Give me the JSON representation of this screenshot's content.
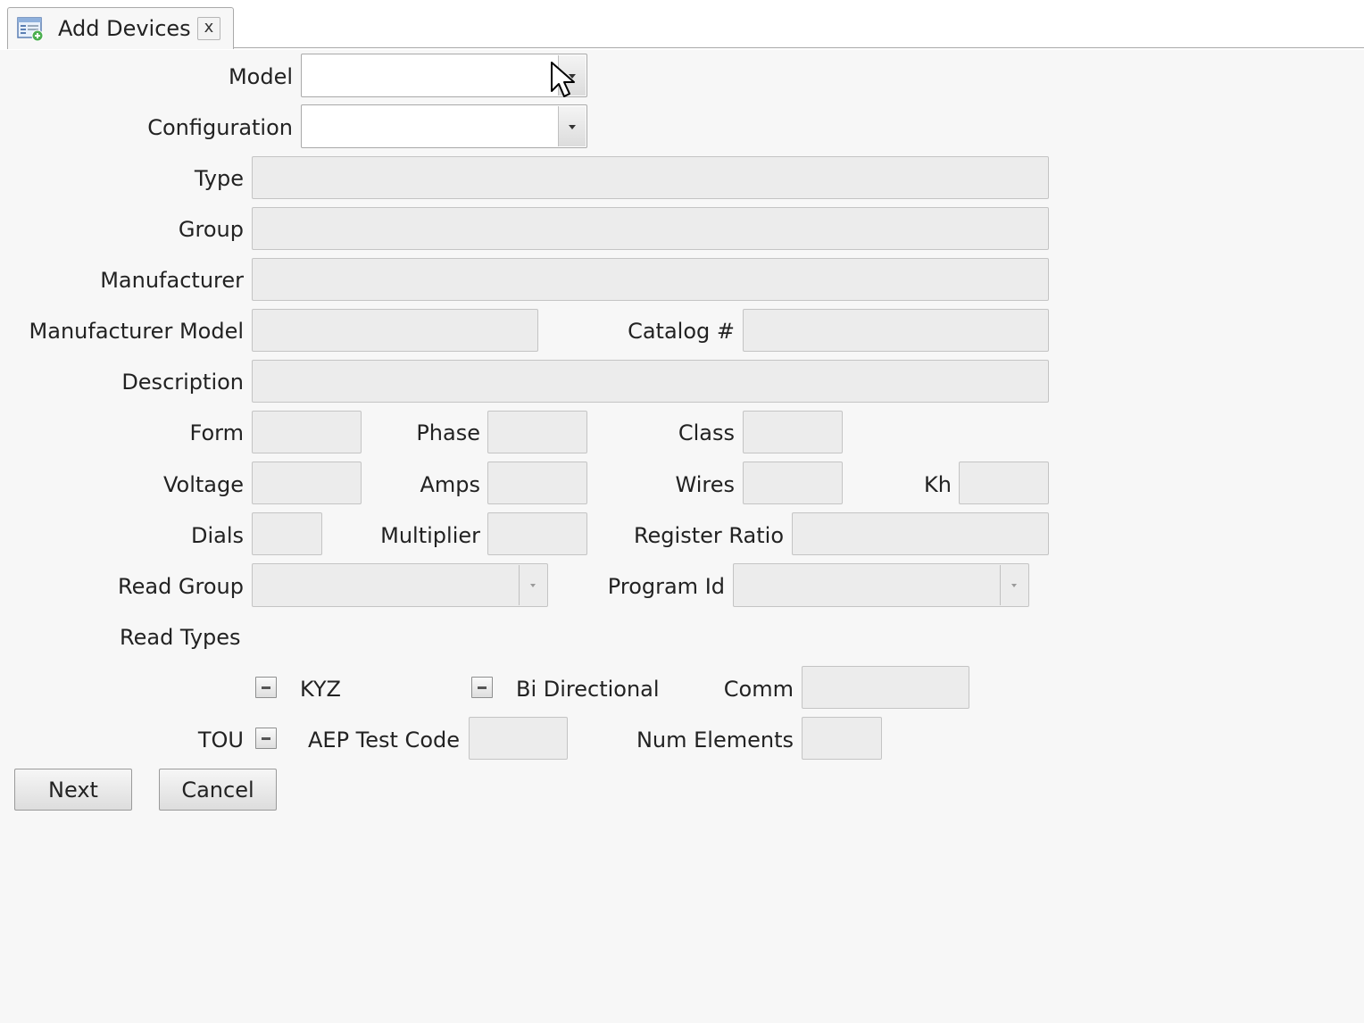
{
  "tab": {
    "title": "Add Devices",
    "close": "x",
    "icon": "add-document-icon"
  },
  "labels": {
    "model": "Model",
    "configuration": "Configuration",
    "type": "Type",
    "group": "Group",
    "manufacturer": "Manufacturer",
    "manufacturer_model": "Manufacturer Model",
    "catalog": "Catalog #",
    "description": "Description",
    "form": "Form",
    "phase": "Phase",
    "class": "Class",
    "voltage": "Voltage",
    "amps": "Amps",
    "wires": "Wires",
    "kh": "Kh",
    "dials": "Dials",
    "multiplier": "Multiplier",
    "register_ratio": "Register Ratio",
    "read_group": "Read Group",
    "program_id": "Program Id",
    "read_types": "Read Types",
    "kyz": "KYZ",
    "bi_directional": "Bi Directional",
    "comm": "Comm",
    "tou": "TOU",
    "aep_test_code": "AEP Test Code",
    "num_elements": "Num Elements"
  },
  "fields": {
    "model": "",
    "configuration": "",
    "type": "",
    "group": "",
    "manufacturer": "",
    "manufacturer_model": "",
    "catalog": "",
    "description": "",
    "form": "",
    "phase": "",
    "class": "",
    "voltage": "",
    "amps": "",
    "wires": "",
    "kh": "",
    "dials": "",
    "multiplier": "",
    "register_ratio": "",
    "read_group": "",
    "program_id": "",
    "comm": "",
    "aep_test_code": "",
    "num_elements": ""
  },
  "checkboxes": {
    "kyz": "indeterminate",
    "bi_directional": "indeterminate",
    "tou": "indeterminate"
  },
  "buttons": {
    "next": "Next",
    "cancel": "Cancel"
  }
}
